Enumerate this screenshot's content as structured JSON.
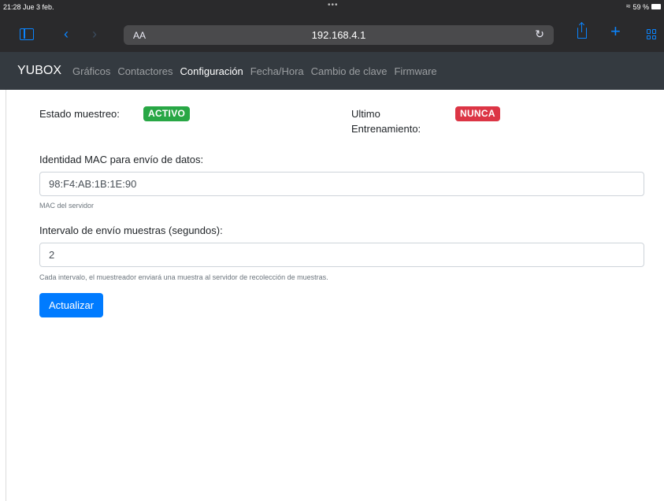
{
  "status_bar": {
    "time": "21:28  Jue 3 feb.",
    "dots": "•••",
    "battery_text": "59 %"
  },
  "browser": {
    "text_size_label": "AA",
    "url": "192.168.4.1",
    "reload_icon": "reload-icon",
    "accent_color": "#0a84ff"
  },
  "navbar": {
    "brand": "YUBOX",
    "links": [
      {
        "label": "Gráficos",
        "active": false
      },
      {
        "label": "Contactores",
        "active": false
      },
      {
        "label": "Configuración",
        "active": true
      },
      {
        "label": "Fecha/Hora",
        "active": false
      },
      {
        "label": "Cambio de clave",
        "active": false
      },
      {
        "label": "Firmware",
        "active": false
      }
    ]
  },
  "status": {
    "sampling_label": "Estado muestreo:",
    "sampling_badge": "ACTIVO",
    "training_label_line1": "Ultimo",
    "training_label_line2": "Entrenamiento:",
    "training_badge": "NUNCA"
  },
  "form": {
    "mac_label": "Identidad MAC para envío de datos:",
    "mac_value": "98:F4:AB:1B:1E:90",
    "mac_help": "MAC del servidor",
    "interval_label": "Intervalo de envío muestras (segundos):",
    "interval_value": "2",
    "interval_help": "Cada intervalo, el muestreador enviará una muestra al servidor de recolección de muestras.",
    "submit_label": "Actualizar"
  },
  "colors": {
    "navbar_bg": "#343a40",
    "success": "#28a745",
    "danger": "#dc3545",
    "primary": "#007bff"
  }
}
